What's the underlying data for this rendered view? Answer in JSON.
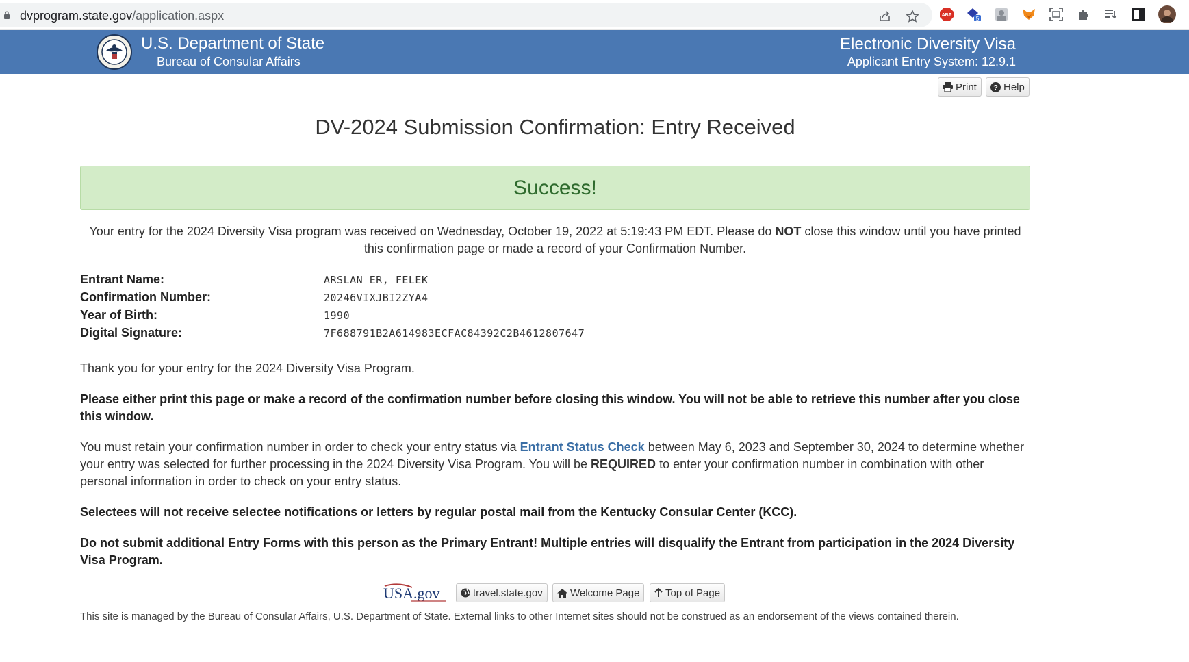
{
  "browser": {
    "url_host": "dvprogram.state.gov",
    "url_path": "/application.aspx",
    "ext_badge_count": "5"
  },
  "header": {
    "department": "U.S. Department of State",
    "bureau": "Bureau of Consular Affairs",
    "system_title": "Electronic Diversity Visa",
    "system_version": "Applicant Entry System: 12.9.1",
    "band_color": "#4a78b3"
  },
  "toolbar": {
    "print_label": "Print",
    "help_label": "Help"
  },
  "page_title": "DV-2024 Submission Confirmation: Entry Received",
  "alert": {
    "text": "Success!",
    "color": "#d3ecc8"
  },
  "intro": {
    "before": "Your entry for the 2024 Diversity Visa program was received on Wednesday, October 19, 2022 at 5:19:43 PM EDT. Please do ",
    "emphasis": "NOT",
    "after": " close this window until you have printed this confirmation page or made a record of your Confirmation Number."
  },
  "entry": {
    "entrant_name_label": "Entrant Name:",
    "entrant_name": "ARSLAN ER, FELEK",
    "confirmation_label": "Confirmation Number:",
    "confirmation_number": "20246VIXJBI2ZYA4",
    "year_label": "Year of Birth:",
    "year_of_birth": "1990",
    "signature_label": "Digital Signature:",
    "digital_signature": "7F688791B2A614983ECFAC84392C2B4612807647"
  },
  "body": {
    "thanks": "Thank you for your entry for the 2024 Diversity Visa Program.",
    "print_warning": "Please either print this page or make a record of the confirmation number before closing this window. You will not be able to retrieve this number after you close this window.",
    "retain_before": "You must retain your confirmation number in order to check your entry status via ",
    "retain_link": "Entrant Status Check",
    "retain_middle": " between May 6, 2023 and September 30, 2024 to determine whether your entry was selected for further processing in the 2024 Diversity Visa Program. You will be ",
    "retain_emphasis": "REQUIRED",
    "retain_after": " to enter your confirmation number in combination with other personal information in order to check on your entry status.",
    "selectees_notice": "Selectees will not receive selectee notifications or letters by regular postal mail from the Kentucky Consular Center (KCC).",
    "multiple_entries_warning": "Do not submit additional Entry Forms with this person as the Primary Entrant! Multiple entries will disqualify the Entrant from participation in the 2024 Diversity Visa Program."
  },
  "footer_nav": {
    "usagov_logo_text": "USA.gov",
    "travel_label": "travel.state.gov",
    "welcome_label": "Welcome Page",
    "top_label": "Top of Page"
  },
  "footer_text": "This site is managed by the Bureau of Consular Affairs, U.S. Department of State. External links to other Internet sites should not be construed as an endorsement of the views contained therein."
}
